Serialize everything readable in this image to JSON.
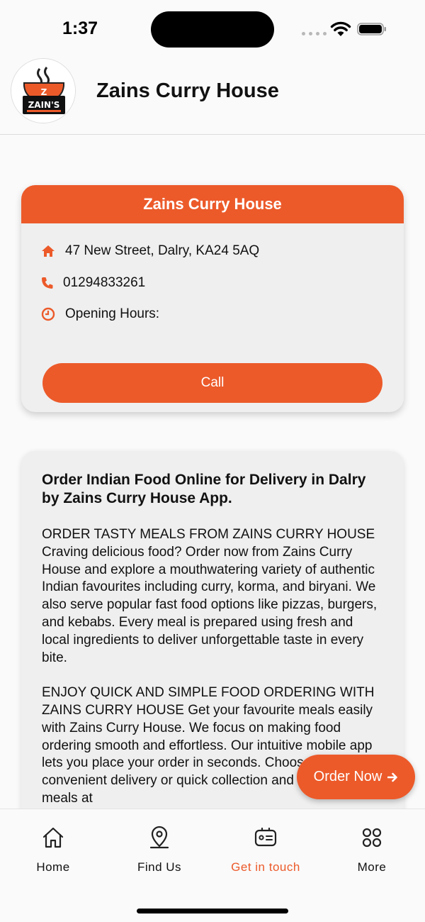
{
  "status_bar": {
    "time": "1:37"
  },
  "header": {
    "title": "Zains Curry House",
    "logo_text": "ZAIN'S",
    "logo_letter": "Z"
  },
  "info_card": {
    "title": "Zains Curry House",
    "address": "47 New Street, Dalry, KA24 5AQ",
    "phone": "01294833261",
    "hours_label": "Opening Hours:",
    "call_label": "Call"
  },
  "about": {
    "heading": "Order Indian Food Online for Delivery in Dalry by Zains Curry House App.",
    "p1": "ORDER TASTY MEALS FROM ZAINS CURRY HOUSE Craving delicious food? Order now from Zains Curry House and explore a mouthwatering variety of authentic Indian favourites including curry, korma, and biryani. We also serve popular fast food options like pizzas, burgers, and kebabs. Every meal is prepared using fresh and local ingredients to deliver unforgettable taste in every bite.",
    "p2": "ENJOY QUICK AND SIMPLE FOOD ORDERING WITH ZAINS CURRY HOUSE Get your favourite meals easily with Zains Curry House. We focus on making food ordering smooth and effortless. Our intuitive mobile app lets you place your order in seconds. Choose between convenient delivery or quick collection and enjoy tasty meals at"
  },
  "order_button": {
    "label": "Order Now"
  },
  "nav": {
    "items": [
      {
        "label": "Home",
        "icon": "home-icon"
      },
      {
        "label": "Find Us",
        "icon": "location-pin-icon"
      },
      {
        "label": "Get in touch",
        "icon": "contact-card-icon"
      },
      {
        "label": "More",
        "icon": "grid-icon"
      }
    ],
    "active_index": 2
  },
  "colors": {
    "accent": "#ec5a2a",
    "card_bg": "#efefef",
    "page_bg": "#fafafa"
  }
}
